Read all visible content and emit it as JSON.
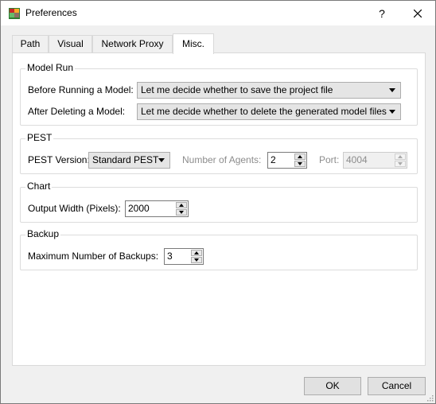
{
  "window": {
    "title": "Preferences",
    "help_label": "?"
  },
  "tabs": [
    {
      "label": "Path"
    },
    {
      "label": "Visual"
    },
    {
      "label": "Network Proxy"
    },
    {
      "label": "Misc."
    }
  ],
  "model_run": {
    "title": "Model Run",
    "before_label": "Before Running a Model:",
    "before_value": "Let me decide whether to save the project file",
    "after_label": "After Deleting a Model:",
    "after_value": "Let me decide whether to delete the generated model files"
  },
  "pest": {
    "title": "PEST",
    "version_label": "PEST Version:",
    "version_value": "Standard PEST",
    "agents_label": "Number of Agents:",
    "agents_value": "2",
    "port_label": "Port:",
    "port_value": "4004"
  },
  "chart": {
    "title": "Chart",
    "width_label": "Output Width (Pixels):",
    "width_value": "2000"
  },
  "backup": {
    "title": "Backup",
    "max_label": "Maximum Number of Backups:",
    "max_value": "3"
  },
  "footer": {
    "ok_label": "OK",
    "cancel_label": "Cancel"
  }
}
